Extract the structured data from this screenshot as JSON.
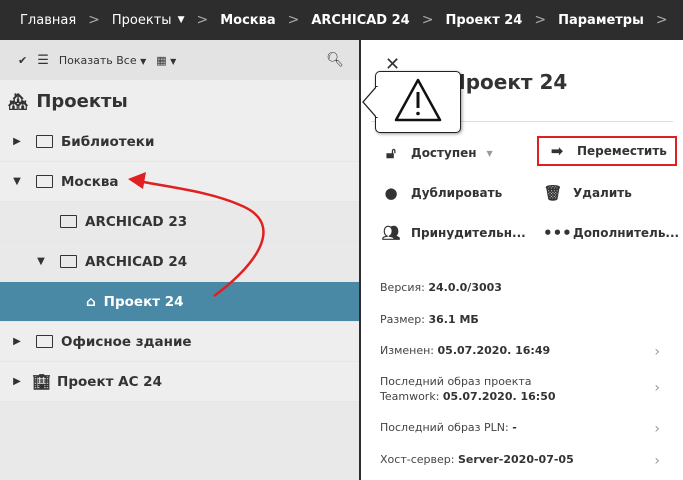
{
  "breadcrumb": [
    "Главная",
    "Проекты",
    "Москва",
    "ARCHICAD 24",
    "Проект 24",
    "Параметры"
  ],
  "toolbar": {
    "filter_label": "Показать Все"
  },
  "left": {
    "title": "Проекты",
    "tree": [
      {
        "label": "Библиотеки",
        "level": 0,
        "expanded": false
      },
      {
        "label": "Москва",
        "level": 0,
        "expanded": true
      },
      {
        "label": "ARCHICAD 23",
        "level": 1
      },
      {
        "label": "ARCHICAD 24",
        "level": 1,
        "expanded": true
      },
      {
        "label": "Проект 24",
        "level": 2,
        "selected": true
      },
      {
        "label": "Офисное здание",
        "level": 0,
        "expanded": false
      },
      {
        "label": "Проект AC 24",
        "level": 0,
        "expanded": false
      }
    ]
  },
  "right": {
    "title": "Проект 24",
    "actions": {
      "status": "Доступен",
      "move": "Переместить",
      "duplicate": "Дублировать",
      "delete": "Удалить",
      "force": "Принудительн...",
      "more": "Дополнитель..."
    },
    "info": {
      "version_label": "Версия:",
      "version": "24.0.0/3003",
      "size_label": "Размер:",
      "size": "36.1 МБ",
      "modified_label": "Изменен:",
      "modified": "05.07.2020. 16:49",
      "teamwork_label": "Последний образ проекта Teamwork:",
      "teamwork": "05.07.2020. 16:50",
      "pln_label": "Последний образ PLN:",
      "pln": "-",
      "host_label": "Хост-сервер:",
      "host": "Server-2020-07-05"
    }
  },
  "colors": {
    "selected": "#4a89a5",
    "highlight": "#e02020"
  }
}
